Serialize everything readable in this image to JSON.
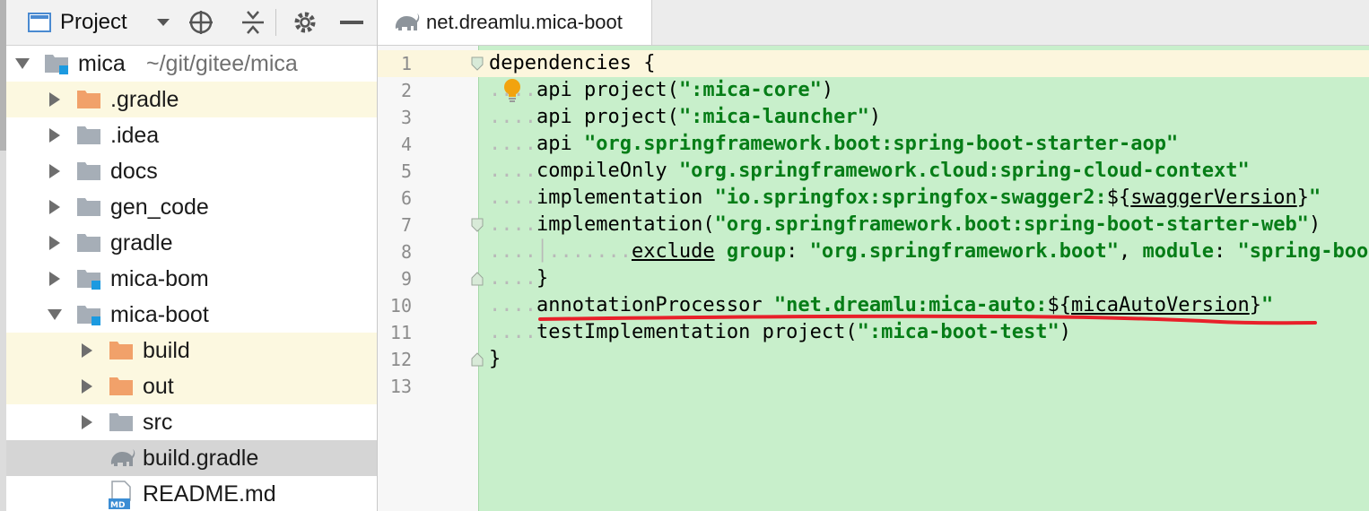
{
  "project_panel": {
    "title": "Project",
    "toolbar_icons": [
      "dropdown-arrow-icon",
      "locate-target-icon",
      "collapse-all-icon",
      "gear-icon",
      "minimize-icon"
    ],
    "tree": [
      {
        "name": "mica",
        "path": "~/git/gitee/mica",
        "expanded": true,
        "icon": "module-folder-icon"
      },
      {
        "name": ".gradle",
        "expanded": false,
        "icon": "excluded-folder-icon",
        "highlight": true
      },
      {
        "name": ".idea",
        "expanded": false,
        "icon": "folder-icon"
      },
      {
        "name": "docs",
        "expanded": false,
        "icon": "folder-icon"
      },
      {
        "name": "gen_code",
        "expanded": false,
        "icon": "folder-icon"
      },
      {
        "name": "gradle",
        "expanded": false,
        "icon": "folder-icon"
      },
      {
        "name": "mica-bom",
        "expanded": false,
        "icon": "module-folder-icon"
      },
      {
        "name": "mica-boot",
        "expanded": true,
        "icon": "module-folder-icon"
      },
      {
        "name": "build",
        "expanded": false,
        "icon": "excluded-folder-icon",
        "highlight": true
      },
      {
        "name": "out",
        "expanded": false,
        "icon": "excluded-folder-icon",
        "highlight": true
      },
      {
        "name": "src",
        "expanded": false,
        "icon": "folder-icon"
      },
      {
        "name": "build.gradle",
        "icon": "gradle-elephant-icon",
        "selected": true
      },
      {
        "name": "README.md",
        "icon": "markdown-file-icon"
      }
    ]
  },
  "editor": {
    "tab_label": "net.dreamlu.mica-boot",
    "tab_icon": "gradle-elephant-icon",
    "line_numbers": [
      "1",
      "2",
      "3",
      "4",
      "5",
      "6",
      "7",
      "8",
      "9",
      "10",
      "11",
      "12",
      "13"
    ],
    "code": {
      "l1": {
        "kw": "dependencies",
        "rest": " {"
      },
      "l2": {
        "kw": "api project(",
        "str": "\":mica-core\"",
        "end": ")"
      },
      "l3": {
        "kw": "api project(",
        "str": "\":mica-launcher\"",
        "end": ")"
      },
      "l4": {
        "kw": "api ",
        "str": "\"org.springframework.boot:spring-boot-starter-aop\""
      },
      "l5": {
        "kw": "compileOnly ",
        "str": "\"org.springframework.cloud:spring-cloud-context\""
      },
      "l6": {
        "kw": "implementation ",
        "str": "\"io.springfox:springfox-swagger2:",
        "d1": "${",
        "var": "swaggerVersion",
        "d2": "}",
        "q": "\""
      },
      "l7": {
        "kw": "implementation(",
        "str": "\"org.springframework.boot:spring-boot-starter-web\"",
        "end": ")"
      },
      "l8": {
        "kw": "exclude",
        "g": " group",
        "c1": ": ",
        "s1": "\"org.springframework.boot\"",
        "c2": ", ",
        "m": "module",
        "c3": ": ",
        "s2": "\"spring-boot"
      },
      "l9": {
        "kw": "}"
      },
      "l10": {
        "kw": "annotationProcessor ",
        "str": "\"net.dreamlu:mica-auto:",
        "d1": "${",
        "var": "micaAutoVersion",
        "d2": "}",
        "q": "\""
      },
      "l11": {
        "kw": "testImplementation project(",
        "str": "\":mica-boot-test\"",
        "end": ")"
      },
      "l12": {
        "kw": "}"
      }
    },
    "colors": {
      "changed_bg": "#c8efcb",
      "string": "#067d17",
      "annotation_red": "#e8202a",
      "bulb": "#f2a30f"
    }
  }
}
